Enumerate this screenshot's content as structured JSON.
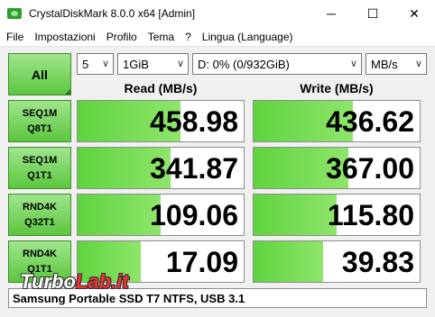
{
  "window": {
    "title": "CrystalDiskMark 8.0.0 x64 [Admin]",
    "minimize_glyph": "─",
    "maximize_glyph": "☐",
    "close_glyph": "✕",
    "icon": "disk-icon"
  },
  "menu": {
    "file": "File",
    "settings": "Impostazioni",
    "profile": "Profilo",
    "theme": "Tema",
    "help": "?",
    "language": "Lingua (Language)"
  },
  "controls": {
    "all_label": "All",
    "count": "5",
    "size": "1GiB",
    "drive": "D: 0% (0/932GiB)",
    "unit": "MB/s"
  },
  "headers": {
    "read": "Read (MB/s)",
    "write": "Write (MB/s)"
  },
  "rows": [
    {
      "line1": "SEQ1M",
      "line2": "Q8T1",
      "read": "458.98",
      "write": "436.62",
      "read_fill": 0.62,
      "write_fill": 0.6
    },
    {
      "line1": "SEQ1M",
      "line2": "Q1T1",
      "read": "341.87",
      "write": "367.00",
      "read_fill": 0.56,
      "write_fill": 0.57
    },
    {
      "line1": "RND4K",
      "line2": "Q32T1",
      "read": "109.06",
      "write": "115.80",
      "read_fill": 0.5,
      "write_fill": 0.5
    },
    {
      "line1": "RND4K",
      "line2": "Q1T1",
      "read": "17.09",
      "write": "39.83",
      "read_fill": 0.38,
      "write_fill": 0.42
    }
  ],
  "footer": {
    "comment": "Samsung Portable SSD T7 NTFS, USB 3.1"
  },
  "watermark": {
    "part1": "Turbo",
    "part2": "Lab.it"
  },
  "colors": {
    "accent_green": "#5cc63e",
    "bar_green": "#8ee56b"
  }
}
